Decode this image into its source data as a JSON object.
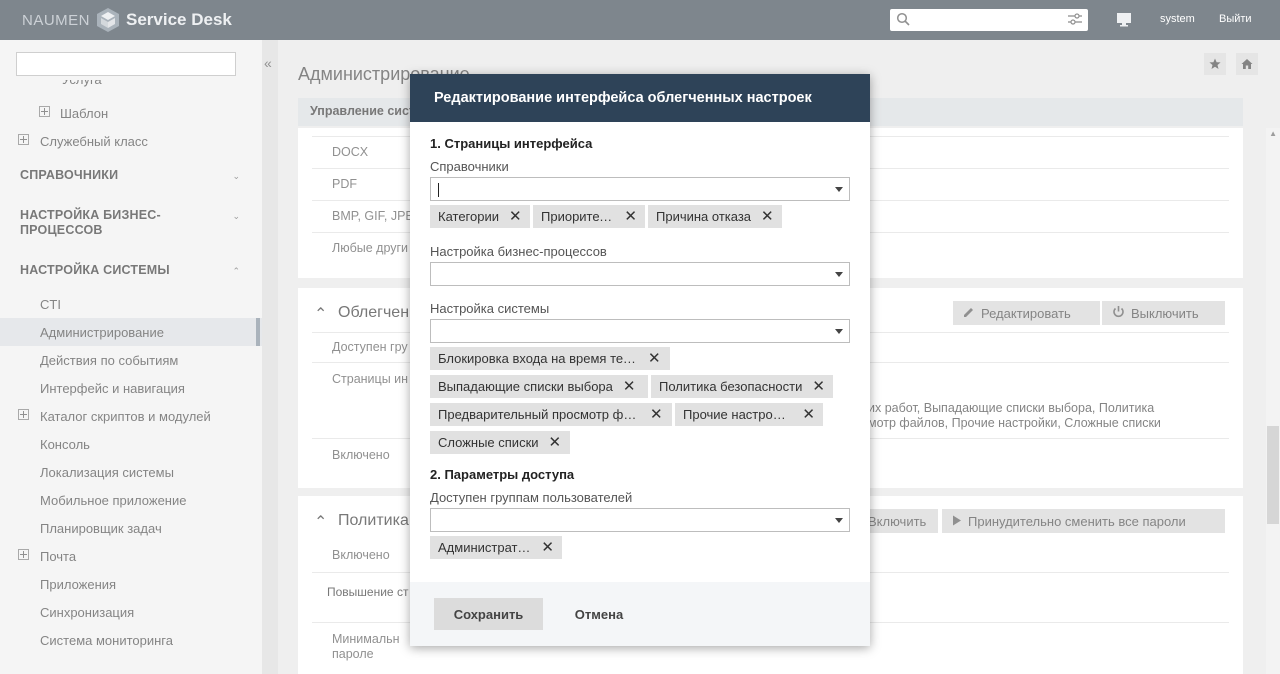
{
  "header": {
    "brand_left": "NAUMEN",
    "brand_right": "Service Desk",
    "search_placeholder": "",
    "user": "system",
    "logout": "Выйти"
  },
  "sidebar": {
    "partial_top": "Услуга",
    "items": [
      {
        "label": "Шаблон"
      },
      {
        "label": "Служебный класс"
      }
    ],
    "sections": [
      {
        "label": "СПРАВОЧНИКИ"
      },
      {
        "label": "НАСТРОЙКА БИЗНЕС-ПРОЦЕССОВ"
      },
      {
        "label": "НАСТРОЙКА СИСТЕМЫ"
      }
    ],
    "system_items": [
      {
        "label": "CTI"
      },
      {
        "label": "Администрирование"
      },
      {
        "label": "Действия по событиям"
      },
      {
        "label": "Интерфейс и навигация"
      },
      {
        "label": "Каталог скриптов и модулей"
      },
      {
        "label": "Консоль"
      },
      {
        "label": "Локализация системы"
      },
      {
        "label": "Мобильное приложение"
      },
      {
        "label": "Планировщик задач"
      },
      {
        "label": "Почта"
      },
      {
        "label": "Приложения"
      },
      {
        "label": "Синхронизация"
      },
      {
        "label": "Система мониторинга"
      }
    ]
  },
  "main": {
    "page_title": "Администрирование",
    "tab": "Управление сист",
    "file_rows": [
      "DOCX",
      "PDF",
      "BMP, GIF, JPE",
      "Любые други"
    ],
    "light_section": {
      "title": "Облегчен",
      "edit_button": "Редактировать",
      "disable_button": "Выключить",
      "rows": [
        "Доступен гру",
        "Страницы ин",
        "Включено"
      ],
      "value_line1": "их работ, Выпадающие списки выбора, Политика",
      "value_line2": "мотр файлов, Прочие настройки, Сложные списки"
    },
    "policy_section": {
      "title": "Политика",
      "enable_button": "Включить",
      "force_button": "Принудительно сменить все пароли",
      "rows": [
        "Включено",
        "Повышение ст",
        "Минимальн",
        "пароле"
      ]
    }
  },
  "dialog": {
    "title": "Редактирование интерфейса облегченных настроек",
    "section1": "1. Страницы интерфейса",
    "field_directories": "Справочники",
    "directories_chips": [
      "Категории",
      "Приоритеты",
      "Причина отказа"
    ],
    "field_bp": "Настройка бизнес-процессов",
    "field_system": "Настройка системы",
    "system_chips": [
      "Блокировка входа на время тех...",
      "Выпадающие списки выбора",
      "Политика безопасности",
      "Предварительный просмотр фа...",
      "Прочие настройки",
      "Сложные списки"
    ],
    "section2": "2. Параметры доступа",
    "field_groups": "Доступен группам пользователей",
    "groups_chips": [
      "Администратор"
    ],
    "save_button": "Сохранить",
    "cancel_button": "Отмена"
  }
}
